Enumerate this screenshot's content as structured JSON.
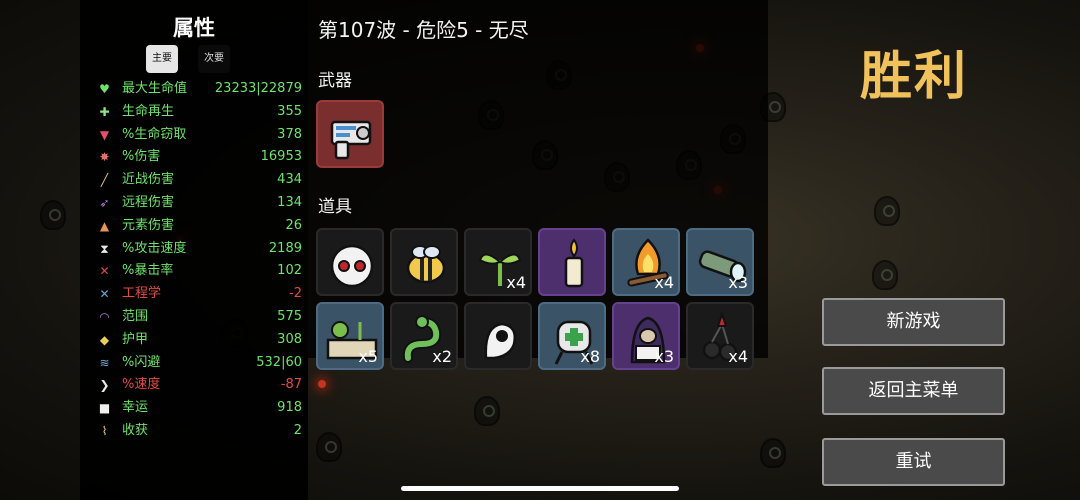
{
  "stats_panel": {
    "title": "属性",
    "tabs": {
      "primary": "主要",
      "secondary": "次要"
    },
    "stats": [
      {
        "name": "最大生命值",
        "value": "23233|22879",
        "tone": "pos",
        "icon": "heart-icon",
        "color": "#6ee26b"
      },
      {
        "name": "生命再生",
        "value": "355",
        "tone": "pos",
        "icon": "regen-icon",
        "color": "#8fe28a"
      },
      {
        "name": "%生命窃取",
        "value": "378",
        "tone": "pos",
        "icon": "lifesteal-icon",
        "color": "#e0506a"
      },
      {
        "name": "%伤害",
        "value": "16953",
        "tone": "pos",
        "icon": "damage-icon",
        "color": "#e07070"
      },
      {
        "name": "近战伤害",
        "value": "434",
        "tone": "pos",
        "icon": "melee-icon",
        "color": "#e7c77a"
      },
      {
        "name": "远程伤害",
        "value": "134",
        "tone": "pos",
        "icon": "ranged-icon",
        "color": "#b27ad9"
      },
      {
        "name": "元素伤害",
        "value": "26",
        "tone": "pos",
        "icon": "elemental-icon",
        "color": "#e8945a"
      },
      {
        "name": "%攻击速度",
        "value": "2189",
        "tone": "pos",
        "icon": "attack-speed-icon",
        "color": "#e6e6e6"
      },
      {
        "name": "%暴击率",
        "value": "102",
        "tone": "pos",
        "icon": "crit-icon",
        "color": "#e04848"
      },
      {
        "name": "工程学",
        "value": "-2",
        "tone": "neg",
        "icon": "engineering-icon",
        "color": "#6aa8d8"
      },
      {
        "name": "范围",
        "value": "575",
        "tone": "pos",
        "icon": "range-icon",
        "color": "#b27ad9"
      },
      {
        "name": "护甲",
        "value": "308",
        "tone": "pos",
        "icon": "armor-icon",
        "color": "#e8cf55"
      },
      {
        "name": "%闪避",
        "value": "532|60",
        "tone": "pos",
        "icon": "dodge-icon",
        "color": "#7aa8d8"
      },
      {
        "name": "%速度",
        "value": "-87",
        "tone": "neg",
        "icon": "speed-icon",
        "color": "#e6e6e6"
      },
      {
        "name": "幸运",
        "value": "918",
        "tone": "pos",
        "icon": "luck-icon",
        "color": "#f0f0f0"
      },
      {
        "name": "收获",
        "value": "2",
        "tone": "pos",
        "icon": "harvest-icon",
        "color": "#e8d37a"
      }
    ]
  },
  "center_panel": {
    "wave_title": "第107波 - 危险5 - 无尽",
    "weapons_label": "武器",
    "items_label": "道具",
    "weapons": [
      {
        "icon": "blaster-gun-icon"
      }
    ],
    "items_row1": [
      {
        "icon": "ghost-mask-icon",
        "count": "",
        "tier": "dark"
      },
      {
        "icon": "bee-icon",
        "count": "",
        "tier": "dark"
      },
      {
        "icon": "sprout-icon",
        "count": "x4",
        "tier": "dark"
      },
      {
        "icon": "candle-icon",
        "count": "",
        "tier": "purple"
      },
      {
        "icon": "campfire-icon",
        "count": "x4",
        "tier": "blue"
      },
      {
        "icon": "flashlight-icon",
        "count": "x3",
        "tier": "blue"
      }
    ],
    "items_row2": [
      {
        "icon": "garden-plot-icon",
        "count": "x5",
        "tier": "blue"
      },
      {
        "icon": "snake-icon",
        "count": "x2",
        "tier": "dark"
      },
      {
        "icon": "ghost-eye-icon",
        "count": "",
        "tier": "dark"
      },
      {
        "icon": "medic-robot-icon",
        "count": "x8",
        "tier": "blue"
      },
      {
        "icon": "hooded-figure-icon",
        "count": "x3",
        "tier": "purple"
      },
      {
        "icon": "cherry-bomb-icon",
        "count": "x4",
        "tier": "dark"
      }
    ]
  },
  "result": {
    "title": "胜利",
    "buttons": {
      "new_game": "新游戏",
      "main_menu": "返回主菜单",
      "retry": "重试"
    }
  }
}
